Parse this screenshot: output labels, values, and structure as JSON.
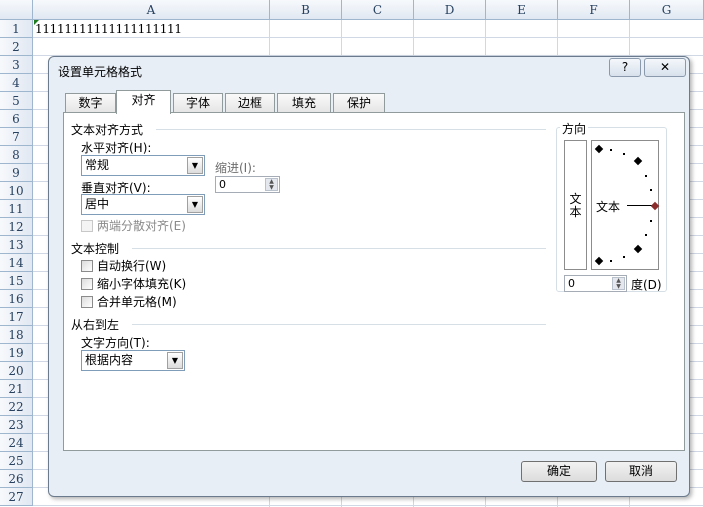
{
  "sheet": {
    "columns": [
      "A",
      "B",
      "C",
      "D",
      "E",
      "F",
      "G"
    ],
    "rows": [
      "1",
      "2",
      "3",
      "4",
      "5",
      "6",
      "7",
      "8",
      "9",
      "10",
      "11",
      "12",
      "13",
      "14",
      "15",
      "16",
      "17",
      "18",
      "19",
      "20",
      "21",
      "22",
      "23",
      "24",
      "25",
      "26",
      "27"
    ],
    "cell_a1": "11111111111111111111"
  },
  "dialog": {
    "title": "设置单元格格式",
    "help_label": "?",
    "close_label": "✕",
    "tabs": [
      "数字",
      "对齐",
      "字体",
      "边框",
      "填充",
      "保护"
    ],
    "active_tab": "对齐",
    "text_alignment": {
      "section": "文本对齐方式",
      "horizontal_label": "水平对齐(H):",
      "horizontal_value": "常规",
      "indent_label": "缩进(I):",
      "indent_value": "0",
      "vertical_label": "垂直对齐(V):",
      "vertical_value": "居中",
      "distributed_label": "两端分散对齐(E)"
    },
    "text_control": {
      "section": "文本控制",
      "wrap_label": "自动换行(W)",
      "shrink_label": "缩小字体填充(K)",
      "merge_label": "合并单元格(M)"
    },
    "rtl": {
      "section": "从右到左",
      "direction_label": "文字方向(T):",
      "direction_value": "根据内容"
    },
    "orientation": {
      "section": "方向",
      "vertical_text": "文本",
      "text": "文本",
      "degrees_value": "0",
      "degrees_label": "度(D)"
    },
    "ok_label": "确定",
    "cancel_label": "取消"
  }
}
